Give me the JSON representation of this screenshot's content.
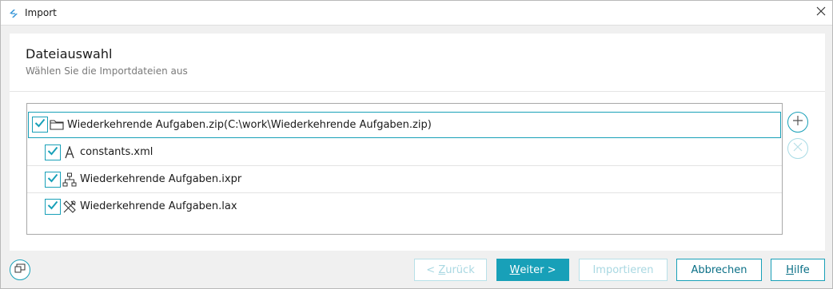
{
  "window": {
    "title": "Import"
  },
  "header": {
    "title": "Dateiauswahl",
    "subtitle": "Wählen Sie die Importdateien aus"
  },
  "files": {
    "root": {
      "name": "Wiederkehrende Aufgaben.zip",
      "path": "(C:\\work\\Wiederkehrende Aufgaben.zip)",
      "checked": true,
      "icon": "folder-icon"
    },
    "children": [
      {
        "name": "constants.xml",
        "checked": true,
        "icon": "text-a-icon"
      },
      {
        "name": "Wiederkehrende Aufgaben.ixpr",
        "checked": true,
        "icon": "hierarchy-icon"
      },
      {
        "name": "Wiederkehrende Aufgaben.lax",
        "checked": true,
        "icon": "tools-icon"
      }
    ]
  },
  "buttons": {
    "back_prefix": "< ",
    "back_key": "Z",
    "back_rest": "urück",
    "next_key": "W",
    "next_rest": "eiter >",
    "import_label": "Importieren",
    "cancel_label": "Abbrechen",
    "help_key": "H",
    "help_rest": "ilfe"
  },
  "colors": {
    "accent": "#18a0b8",
    "disabled": "#a9d8e2"
  }
}
